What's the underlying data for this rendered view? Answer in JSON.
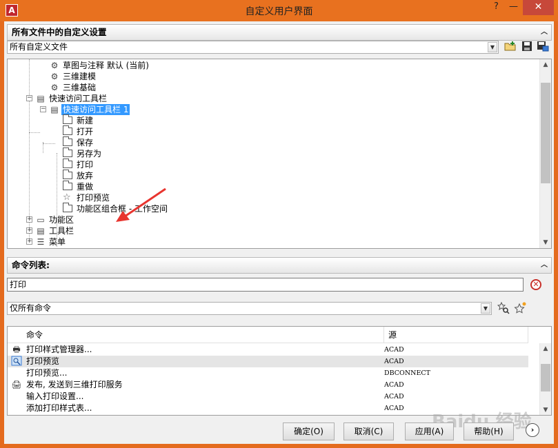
{
  "window": {
    "title": "自定义用户界面",
    "app_icon": "A",
    "help_glyph": "?",
    "minimize_glyph": "—",
    "close_glyph": "✕"
  },
  "top_panel": {
    "header": "所有文件中的自定义设置",
    "file_combo_value": "所有自定义文件",
    "tree": [
      {
        "label": "草图与注释 默认 (当前)",
        "icon": "gear-icon"
      },
      {
        "label": "三维建模",
        "icon": "gear-icon"
      },
      {
        "label": "三维基础",
        "icon": "gear-icon"
      },
      {
        "label": "快速访问工具栏",
        "icon": "toolbar-icon",
        "expanded": true
      },
      {
        "label": "快速访问工具栏 1",
        "icon": "toolbar-icon",
        "expanded": true,
        "selected": true
      },
      {
        "label": "新建",
        "icon": "folder-icon"
      },
      {
        "label": "打开",
        "icon": "folder-icon"
      },
      {
        "label": "保存",
        "icon": "folder-icon"
      },
      {
        "label": "另存为",
        "icon": "folder-icon"
      },
      {
        "label": "打印",
        "icon": "folder-icon"
      },
      {
        "label": "放弃",
        "icon": "folder-icon"
      },
      {
        "label": "重做",
        "icon": "folder-icon"
      },
      {
        "label": "打印预览",
        "icon": "star-icon"
      },
      {
        "label": "功能区组合框 - 工作空间",
        "icon": "folder-icon"
      },
      {
        "label": "功能区",
        "icon": "ribbon-icon"
      },
      {
        "label": "工具栏",
        "icon": "toolbar-icon"
      },
      {
        "label": "菜单",
        "icon": "menu-icon"
      }
    ]
  },
  "command_panel": {
    "header": "命令列表:",
    "search_value": "打印",
    "filter_value": "仅所有命令",
    "columns": [
      "命令",
      "源"
    ],
    "rows": [
      {
        "command": "打印样式管理器...",
        "source": "ACAD",
        "icon": "printer-icon"
      },
      {
        "command": "打印预览",
        "source": "ACAD",
        "icon": "preview-icon",
        "highlight": true
      },
      {
        "command": "打印预览...",
        "source": "DBCONNECT",
        "icon": ""
      },
      {
        "command": "发布, 发送到三维打印服务",
        "source": "ACAD",
        "icon": "printer-3d-icon"
      },
      {
        "command": "输入打印设置...",
        "source": "ACAD",
        "icon": ""
      },
      {
        "command": "添加打印样式表...",
        "source": "ACAD",
        "icon": ""
      }
    ]
  },
  "buttons": {
    "ok": "确定(O)",
    "cancel": "取消(C)",
    "apply": "应用(A)",
    "help": "帮助(H)",
    "more": "›"
  },
  "watermark": "Baidu 经验",
  "colors": {
    "titlebar": "#e8711f",
    "close_button": "#c7483a",
    "selection": "#3399ff",
    "annotation_arrow": "#e8352f"
  }
}
